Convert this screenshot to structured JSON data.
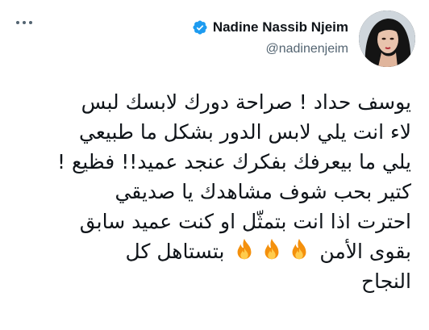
{
  "author": {
    "display_name": "Nadine Nassib Njeim",
    "handle": "@nadinenjeim",
    "verified": true,
    "verified_color": "#1d9bf0"
  },
  "menu": {
    "icon": "more-horizontal-icon"
  },
  "tweet": {
    "lines": [
      "يوسف حداد ! صراحة دورك لابسك لبس",
      "لاء انت يلي لابس الدور بشكل ما طبيعي",
      "يلي ما بيعرفك بفكرك عنجد عميد!! فظيع !",
      "كتير بحب شوف مشاهدك يا صديقي",
      "احترت اذا انت بتمثّل او كنت عميد سابق",
      "بقوى الأمن",
      "بتستاهل كل",
      "النجاح"
    ],
    "emoji": [
      "fire-emoji",
      "fire-emoji",
      "fire-emoji"
    ]
  }
}
